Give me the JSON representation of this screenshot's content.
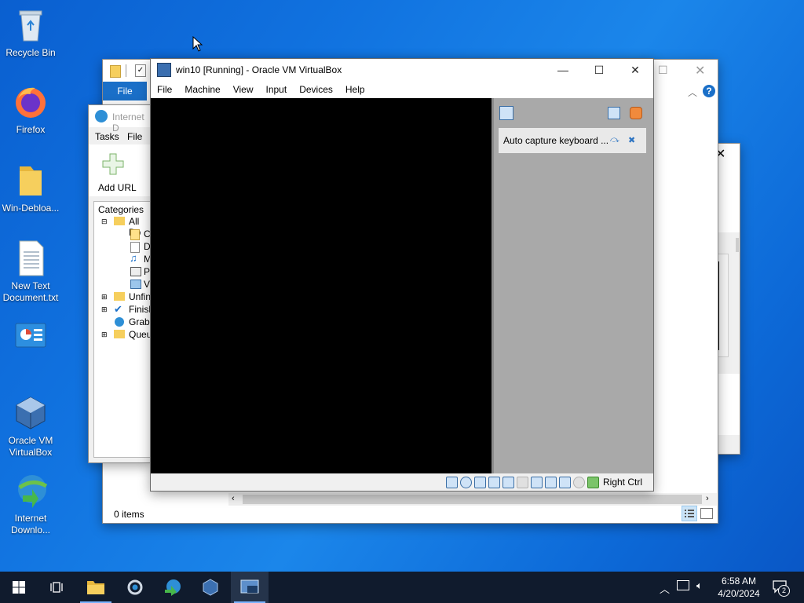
{
  "desktop": {
    "icons": [
      {
        "label": "Recycle Bin",
        "icon": "recycle-bin-icon"
      },
      {
        "label": "Firefox",
        "icon": "firefox-icon"
      },
      {
        "label": "Win-Debloa...",
        "icon": "folder-icon"
      },
      {
        "label": "New Text Document.txt",
        "icon": "text-file-icon"
      },
      {
        "label": "",
        "icon": "control-panel-icon"
      },
      {
        "label": "Oracle VM VirtualBox",
        "icon": "virtualbox-icon"
      },
      {
        "label": "Internet Downlo...",
        "icon": "idm-icon"
      }
    ]
  },
  "explorer": {
    "ribbon_file": "File",
    "status_items": "0 items"
  },
  "idm": {
    "title": "Internet D",
    "menu": [
      "Tasks",
      "File"
    ],
    "add_url": "Add URL",
    "categories_label": "Categories",
    "tree": [
      "All Do",
      "Co",
      "Do",
      "Mu",
      "Pr",
      "Vi",
      "Unfini",
      "Finish",
      "Grabb",
      "Queue"
    ]
  },
  "vbox": {
    "title": "win10 [Running] - Oracle VM VirtualBox",
    "menu": [
      "File",
      "Machine",
      "View",
      "Input",
      "Devices",
      "Help"
    ],
    "notification": "Auto capture keyboard ...",
    "host_key": "Right Ctrl"
  },
  "background_window": {
    "fragment": "0"
  },
  "taskbar": {
    "time": "6:58 AM",
    "date": "4/20/2024",
    "notification_count": "2",
    "accent": "#7ab3ff"
  }
}
